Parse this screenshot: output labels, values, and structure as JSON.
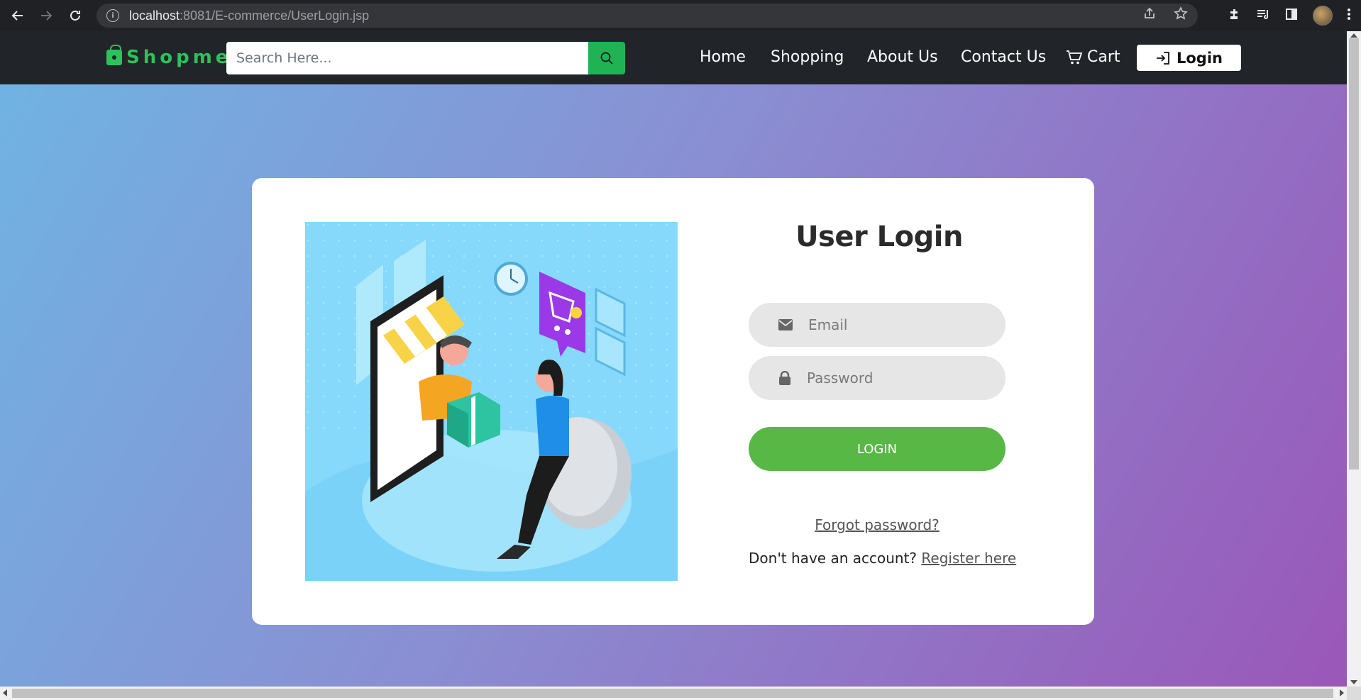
{
  "browser": {
    "url_host": "localhost",
    "url_path": ":8081/E-commerce/UserLogin.jsp",
    "icons": [
      "back-icon",
      "forward-icon",
      "reload-icon",
      "info-icon",
      "share-icon",
      "star-icon",
      "extensions-icon",
      "media-icon",
      "sidepanel-icon",
      "avatar",
      "kebab-menu-icon"
    ]
  },
  "navbar": {
    "brand": "Shopme",
    "search_placeholder": "Search Here...",
    "links": {
      "home": "Home",
      "shopping": "Shopping",
      "about": "About Us",
      "contact": "Contact Us",
      "cart": "Cart"
    },
    "login": "Login"
  },
  "login": {
    "title": "User Login",
    "email_placeholder": "Email",
    "password_placeholder": "Password",
    "submit": "LOGIN",
    "forgot": "Forgot password?",
    "register_prompt": "Don't have an account?",
    "register_link": "Register here"
  },
  "colors": {
    "brand_green": "#2ec15a",
    "login_button": "#57b846",
    "navbar_bg": "#212529",
    "gradient_start": "#70b3e3",
    "gradient_end": "#9a57b8"
  }
}
